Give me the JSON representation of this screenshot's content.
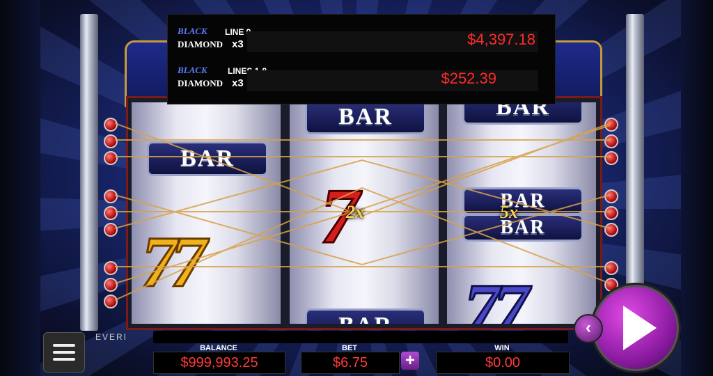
{
  "jackpots": [
    {
      "logo_top": "BLACK",
      "logo_bottom": "DIAMOND",
      "line": "LINE 9",
      "mult": "x3",
      "value": "$4,397.18"
    },
    {
      "logo_top": "BLACK",
      "logo_bottom": "DIAMOND",
      "line": "LINES 1-8",
      "mult": "x3",
      "value": "$252.39"
    }
  ],
  "reels": {
    "bar_label": "BAR",
    "seven": "7",
    "sevens": "77",
    "multipliers": [
      "2x",
      "5x"
    ]
  },
  "footer": {
    "brand": "EVERI",
    "balance_label": "BALANCE",
    "balance_value": "$999,993.25",
    "bet_label": "BET",
    "bet_value": "$6.75",
    "win_label": "WIN",
    "win_value": "$0.00",
    "plus_label": "+",
    "back_label": "‹"
  },
  "icons": [
    "menu-icon",
    "spin-icon",
    "back-icon",
    "plus-icon"
  ],
  "colors": {
    "accent": "#9a2bb0",
    "value_red": "#ff2a2a",
    "reel_blue": "#1e2a8a"
  }
}
